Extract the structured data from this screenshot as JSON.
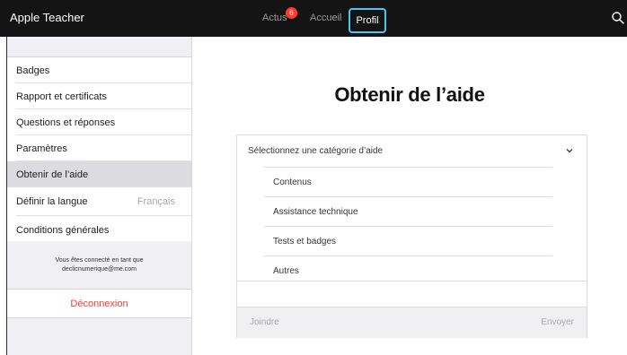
{
  "header": {
    "app_title": "Apple Teacher",
    "tabs": [
      {
        "label": "Actus",
        "badge": "6"
      },
      {
        "label": "Accueil"
      },
      {
        "label": "Profil",
        "selected": true
      }
    ],
    "search_icon": "search-icon"
  },
  "sidebar": {
    "items": [
      {
        "label": "Badges"
      },
      {
        "label": "Rapport et certificats"
      },
      {
        "label": "Questions et réponses"
      },
      {
        "label": "Paramètres"
      },
      {
        "label": "Obtenir de l’aide",
        "selected": true
      },
      {
        "label": "Définir la langue",
        "value": "Français"
      },
      {
        "label": "Conditions générales"
      }
    ],
    "account_line1": "Vous êtes connecté en tant que",
    "account_line2": "declicnumerique@me.com",
    "logout_label": "Déconnexion"
  },
  "main": {
    "title": "Obtenir de l’aide",
    "category_placeholder": "Sélectionnez une catégorie d’aide",
    "options": [
      {
        "label": "Contenus"
      },
      {
        "label": "Assistance technique"
      },
      {
        "label": "Tests et badges"
      },
      {
        "label": "Autres"
      }
    ],
    "attach_label": "Joindre",
    "send_label": "Envoyer"
  },
  "colors": {
    "accent_highlight": "#4cc6f0",
    "badge_red": "#ff3b30",
    "logout_red": "#ff3b30"
  }
}
